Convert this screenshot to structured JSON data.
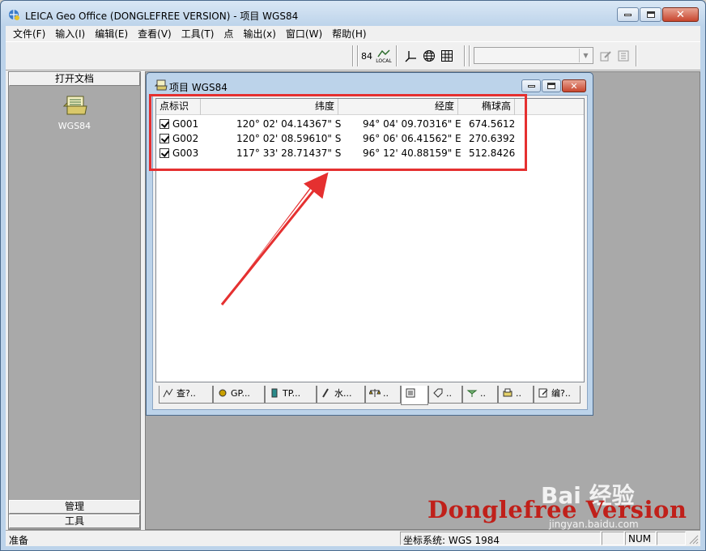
{
  "window": {
    "title": "LEICA Geo Office (DONGLEFREE VERSION) - 项目 WGS84"
  },
  "menu": [
    "文件(F)",
    "输入(I)",
    "编辑(E)",
    "查看(V)",
    "工具(T)",
    "点",
    "输出(x)",
    "窗口(W)",
    "帮助(H)"
  ],
  "toolbar": {
    "coord_label": "84",
    "coord_sub": "LOCAL",
    "combo_value": ""
  },
  "left_panel": {
    "header": "打开文档",
    "document_label": "WGS84",
    "footer_items": [
      "管理",
      "工具"
    ]
  },
  "child_window": {
    "title": "项目 WGS84",
    "columns": [
      "点标识",
      "纬度",
      "经度",
      "椭球高"
    ],
    "rows": [
      {
        "id": "G001",
        "lat": "120° 02' 04.14367\" S",
        "lon": "94° 04' 09.70316\" E",
        "height": "674.5612",
        "checked": true
      },
      {
        "id": "G002",
        "lat": "120° 02' 08.59610\" S",
        "lon": "96° 06' 06.41562\" E",
        "height": "270.6392",
        "checked": true
      },
      {
        "id": "G003",
        "lat": "117° 33' 28.71437\" S",
        "lon": "96° 12' 40.88159\" E",
        "height": "512.8426",
        "checked": true
      }
    ],
    "tabs": [
      "查?..",
      "GP...",
      "TP...",
      "水...",
      "..",
      "",
      "..",
      "..",
      "..",
      "编?.."
    ]
  },
  "watermark": {
    "text": "Donglefree Version",
    "baidu": "Bai 经验",
    "baidu_sub": "jingyan.baidu.com"
  },
  "statusbar": {
    "left": "准备",
    "coord_system": "坐标系统: WGS 1984",
    "num": "NUM"
  },
  "colors": {
    "highlight": "#e53030",
    "watermark": "#c0201a",
    "mdi_background": "#a9a9a9"
  }
}
